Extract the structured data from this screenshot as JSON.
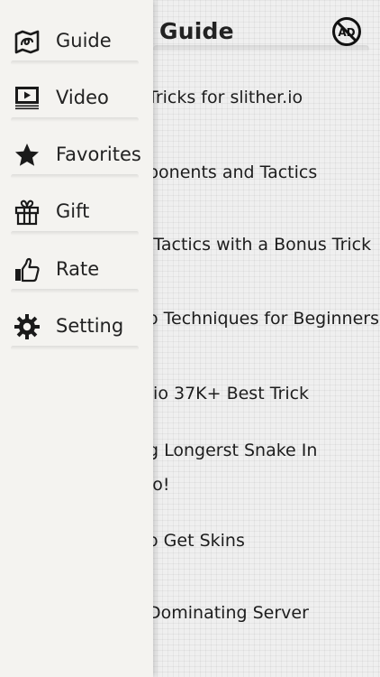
{
  "header": {
    "title": "Guide",
    "noad_icon": "no-ads-icon"
  },
  "articles": [
    {
      "lines": [
        "Tricks for slither.io"
      ]
    },
    {
      "lines": [
        "ponents and Tactics"
      ]
    },
    {
      "lines": [
        "/Tactics with a Bonus Trick"
      ]
    },
    {
      "lines": [
        "o Techniques for Beginners"
      ]
    },
    {
      "lines": [
        ".io 37K+ Best Trick"
      ]
    },
    {
      "lines": [
        "g Longerst Snake In",
        "io!"
      ]
    },
    {
      "lines": [
        "o Get Skins"
      ]
    },
    {
      "lines": [
        "Dominating Server"
      ]
    }
  ],
  "drawer": {
    "items": [
      {
        "label": "Guide",
        "icon": "guide-map-icon"
      },
      {
        "label": "Video",
        "icon": "video-icon"
      },
      {
        "label": "Favorites",
        "icon": "star-icon"
      },
      {
        "label": "Gift",
        "icon": "gift-icon"
      },
      {
        "label": "Rate",
        "icon": "thumbs-up-icon"
      },
      {
        "label": "Setting",
        "icon": "gear-icon"
      }
    ]
  },
  "colors": {
    "drawer_bg": "#f4f3f0",
    "text": "#222222",
    "icon": "#1a1a1a"
  }
}
